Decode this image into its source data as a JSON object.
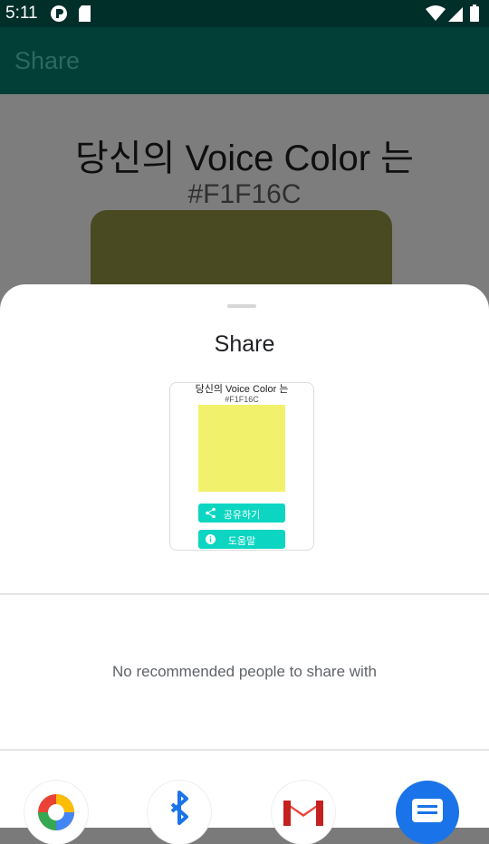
{
  "status_bar": {
    "time": "5:11"
  },
  "app_bar": {
    "title": "Share"
  },
  "background_content": {
    "headline": "당신의 Voice Color 는",
    "hex": "#F1F16C"
  },
  "share_sheet": {
    "title": "Share",
    "preview": {
      "headline": "당신의 Voice Color 는",
      "hex": "#F1F16C",
      "swatch_color": "#F1F16C",
      "share_button": "공유하기",
      "help_button": "도움말"
    },
    "no_recommendations": "No recommended people to share with",
    "apps": [
      {
        "icon": "google-maps-icon"
      },
      {
        "icon": "bluetooth-icon"
      },
      {
        "icon": "gmail-icon"
      },
      {
        "icon": "messages-icon"
      }
    ]
  }
}
